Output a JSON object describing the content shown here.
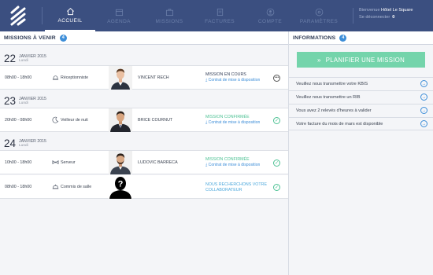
{
  "nav": {
    "items": [
      {
        "label": "ACCUEIL",
        "icon": "home-icon"
      },
      {
        "label": "AGENDA",
        "icon": "calendar-icon"
      },
      {
        "label": "MISSIONS",
        "icon": "briefcase-icon"
      },
      {
        "label": "FACTURES",
        "icon": "invoice-icon"
      },
      {
        "label": "COMPTE",
        "icon": "user-icon"
      },
      {
        "label": "PARAMÈTRES",
        "icon": "settings-icon"
      }
    ]
  },
  "user": {
    "welcome": "Bienvenue",
    "name": "Hôtel Le Square",
    "logout": "Se déconnecter",
    "count": "0"
  },
  "missions": {
    "title": "MISSIONS À VENIR",
    "badge": "4",
    "days": [
      {
        "day": "22",
        "month": "JANVIER 2015",
        "weekday": "Lundi"
      },
      {
        "day": "23",
        "month": "JANVIER 2015",
        "weekday": "Lundi"
      },
      {
        "day": "24",
        "month": "JANVIER 2015",
        "weekday": "Lundi"
      }
    ],
    "rows": [
      {
        "time": "08h00 - 18h00",
        "role": "Réceptionniste",
        "role_icon": "bell-icon",
        "name": "VINCENT RECH",
        "status": "MISSION EN COURS",
        "status_color": "#2f3b55",
        "sub": "Contrat de mise à disposition",
        "state_icon": "more-icon"
      },
      {
        "time": "20h00 - 08h00",
        "role": "Veilleur de nuit",
        "role_icon": "moon-icon",
        "name": "BRICE COURNUT",
        "status": "MISSION CONFIRMÉE",
        "status_color": "#4cc193",
        "sub": "Contrat de mise à disposition",
        "state_icon": "check-icon"
      },
      {
        "time": "10h00 - 18h00",
        "role": "Serveur",
        "role_icon": "bowtie-icon",
        "name": "LUDOVIC BARRECA",
        "status": "MISSION CONFIRMÉE",
        "status_color": "#4cc193",
        "sub": "Contrat de mise à disposition",
        "state_icon": "check-icon"
      },
      {
        "time": "08h00 - 18h00",
        "role": "Commis de salle",
        "role_icon": "cloche-icon",
        "name": "",
        "status": "NOUS RECHERCHONS VOTRE COLLABORATEUR",
        "status_color": "#4da8dc",
        "sub": "",
        "state_icon": "check-icon"
      }
    ]
  },
  "informations": {
    "title": "INFORMATIONS",
    "badge": "4",
    "button": "PLANIFIER UNE MISSION",
    "items": [
      "Veuillez nous transmettre votre KBIS",
      "Veuillez nous transmettre un RIB",
      "Vous avez 2 relevés d'heures à valider",
      "Votre facture du mois de mars est disponible"
    ]
  },
  "colors": {
    "header": "#3b4f80",
    "accent": "#3d8ed8",
    "green": "#74d4ab"
  }
}
